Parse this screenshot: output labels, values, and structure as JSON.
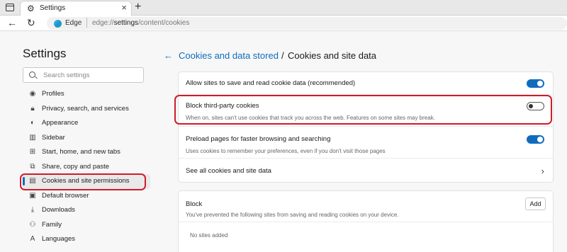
{
  "browser": {
    "tab_title": "Settings",
    "address_brand": "Edge",
    "address_url_prefix": "edge://",
    "address_url_path": "settings",
    "address_url_suffix": "/content/cookies"
  },
  "sidebar": {
    "title": "Settings",
    "search_placeholder": "Search settings",
    "items": [
      {
        "label": "Profiles",
        "icon": "profile-icon"
      },
      {
        "label": "Privacy, search, and services",
        "icon": "lock-icon"
      },
      {
        "label": "Appearance",
        "icon": "appearance-icon"
      },
      {
        "label": "Sidebar",
        "icon": "sidebar-icon"
      },
      {
        "label": "Start, home, and new tabs",
        "icon": "home-icon"
      },
      {
        "label": "Share, copy and paste",
        "icon": "share-icon"
      },
      {
        "label": "Cookies and site permissions",
        "icon": "cookies-icon",
        "active": true
      },
      {
        "label": "Default browser",
        "icon": "browser-icon"
      },
      {
        "label": "Downloads",
        "icon": "download-icon"
      },
      {
        "label": "Family",
        "icon": "family-icon"
      },
      {
        "label": "Languages",
        "icon": "languages-icon"
      }
    ]
  },
  "main": {
    "breadcrumb_parent": "Cookies and data stored",
    "breadcrumb_separator": "/",
    "breadcrumb_current": "Cookies and site data",
    "settings": [
      {
        "title": "Allow sites to save and read cookie data (recommended)",
        "enabled": true
      },
      {
        "title": "Block third-party cookies",
        "description": "When on, sites can't use cookies that track you across the web. Features on some sites may break.",
        "enabled": false
      },
      {
        "title": "Preload pages for faster browsing and searching",
        "description": "Uses cookies to remember your preferences, even if you don't visit those pages",
        "enabled": true
      }
    ],
    "see_all_label": "See all cookies and site data",
    "block": {
      "title": "Block",
      "description": "You've prevented the following sites from saving and reading cookies on your device.",
      "add_label": "Add",
      "empty_text": "No sites added"
    }
  },
  "colors": {
    "accent": "#0f6cbd",
    "highlight": "#d11b2a"
  }
}
